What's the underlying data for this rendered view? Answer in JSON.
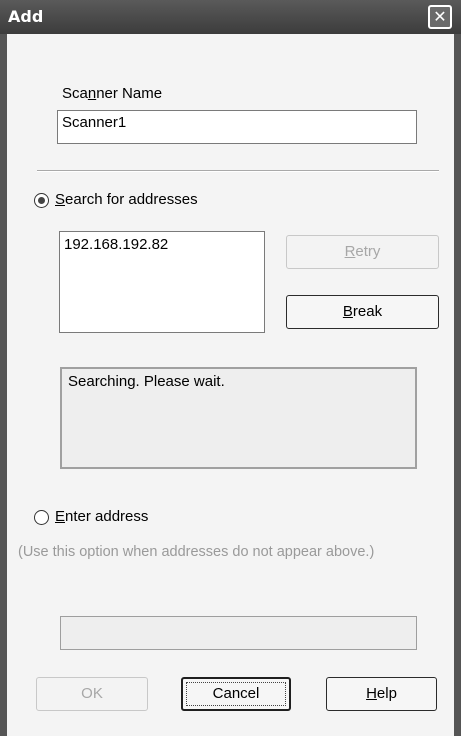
{
  "window": {
    "title": "Add",
    "close_glyph": "✕"
  },
  "scanner_name": {
    "label_pre": "Sca",
    "label_mnemonic": "n",
    "label_post": "ner Name",
    "value": "Scanner1"
  },
  "search": {
    "radio_selected": true,
    "label_mnemonic": "S",
    "label_post": "earch for addresses",
    "results": [
      "192.168.192.82"
    ],
    "retry_mnemonic": "R",
    "retry_post": "etry",
    "break_mnemonic": "B",
    "break_post": "reak",
    "status_text": "Searching. Please wait."
  },
  "enter_address": {
    "radio_selected": false,
    "label_mnemonic": "E",
    "label_post": "nter address",
    "hint": "(Use this option when addresses do not appear above.)",
    "value": ""
  },
  "buttons": {
    "ok": "OK",
    "cancel": "Cancel",
    "help_mnemonic": "H",
    "help_post": "elp"
  }
}
